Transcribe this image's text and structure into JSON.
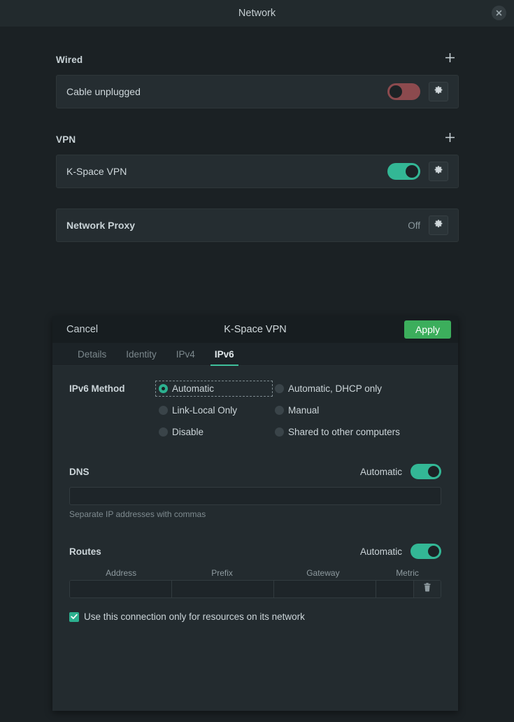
{
  "window": {
    "title": "Network",
    "close_icon": "close-icon"
  },
  "sections": {
    "wired": {
      "title": "Wired",
      "add_icon": "plus-icon",
      "row": {
        "label": "Cable unplugged",
        "toggle_state": "off",
        "settings_icon": "gear-icon"
      }
    },
    "vpn": {
      "title": "VPN",
      "add_icon": "plus-icon",
      "row": {
        "label": "K-Space VPN",
        "toggle_state": "on",
        "settings_icon": "gear-icon"
      }
    },
    "proxy": {
      "label": "Network Proxy",
      "status": "Off",
      "settings_icon": "gear-icon"
    }
  },
  "dialog": {
    "cancel_label": "Cancel",
    "title": "K-Space VPN",
    "apply_label": "Apply",
    "apply_color": "#3cae5c",
    "accent_color": "#3fbf9b",
    "tabs": [
      {
        "label": "Details",
        "active": false
      },
      {
        "label": "Identity",
        "active": false
      },
      {
        "label": "IPv4",
        "active": false
      },
      {
        "label": "IPv6",
        "active": true
      }
    ],
    "method": {
      "label": "IPv6 Method",
      "options": [
        {
          "label": "Automatic",
          "selected": true,
          "focused": true
        },
        {
          "label": "Automatic, DHCP only",
          "selected": false,
          "focused": false
        },
        {
          "label": "Link-Local Only",
          "selected": false,
          "focused": false
        },
        {
          "label": "Manual",
          "selected": false,
          "focused": false
        },
        {
          "label": "Disable",
          "selected": false,
          "focused": false
        },
        {
          "label": "Shared to other computers",
          "selected": false,
          "focused": false
        }
      ]
    },
    "dns": {
      "title": "DNS",
      "auto_label": "Automatic",
      "auto_state": "on",
      "value": "",
      "placeholder": "",
      "hint": "Separate IP addresses with commas"
    },
    "routes": {
      "title": "Routes",
      "auto_label": "Automatic",
      "auto_state": "on",
      "columns": [
        "Address",
        "Prefix",
        "Gateway",
        "Metric"
      ],
      "rows": [
        {
          "address": "",
          "prefix": "",
          "gateway": "",
          "metric": ""
        }
      ],
      "delete_icon": "trash-icon"
    },
    "restrict_checkbox": {
      "label": "Use this connection only for resources on its network",
      "checked": true
    }
  }
}
